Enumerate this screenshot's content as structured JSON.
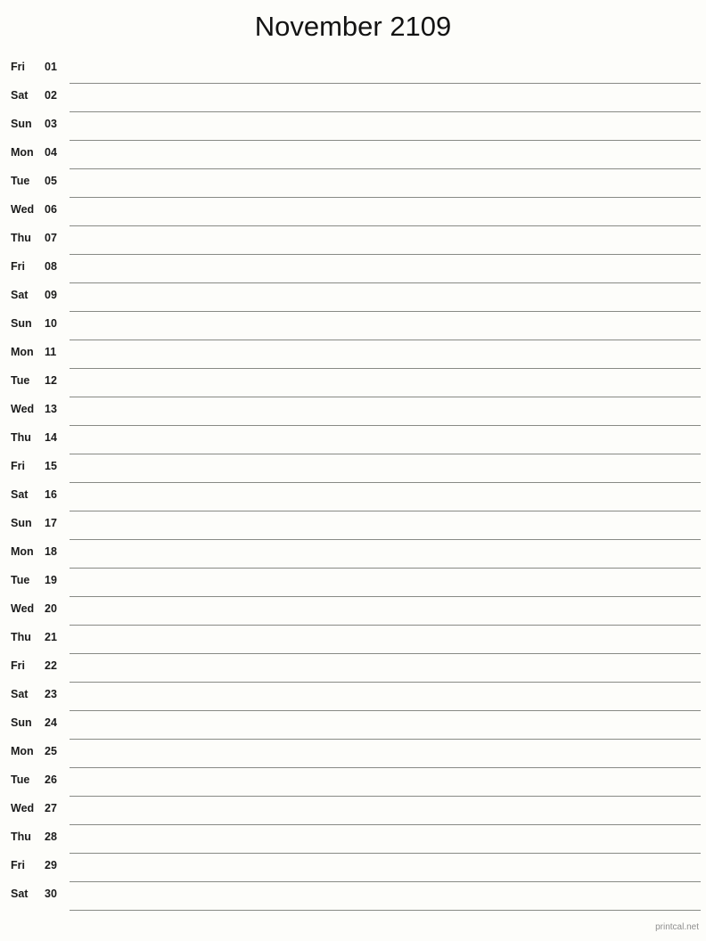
{
  "page": {
    "title": "November 2109",
    "month_name": "November",
    "year": "2109",
    "background_color": "#fdfdfa",
    "rule_color": "#888a85",
    "text_color": "#1b1b1b"
  },
  "footer": {
    "credit": "printcal.net"
  },
  "days": [
    {
      "weekday": "Fri",
      "date": "01"
    },
    {
      "weekday": "Sat",
      "date": "02"
    },
    {
      "weekday": "Sun",
      "date": "03"
    },
    {
      "weekday": "Mon",
      "date": "04"
    },
    {
      "weekday": "Tue",
      "date": "05"
    },
    {
      "weekday": "Wed",
      "date": "06"
    },
    {
      "weekday": "Thu",
      "date": "07"
    },
    {
      "weekday": "Fri",
      "date": "08"
    },
    {
      "weekday": "Sat",
      "date": "09"
    },
    {
      "weekday": "Sun",
      "date": "10"
    },
    {
      "weekday": "Mon",
      "date": "11"
    },
    {
      "weekday": "Tue",
      "date": "12"
    },
    {
      "weekday": "Wed",
      "date": "13"
    },
    {
      "weekday": "Thu",
      "date": "14"
    },
    {
      "weekday": "Fri",
      "date": "15"
    },
    {
      "weekday": "Sat",
      "date": "16"
    },
    {
      "weekday": "Sun",
      "date": "17"
    },
    {
      "weekday": "Mon",
      "date": "18"
    },
    {
      "weekday": "Tue",
      "date": "19"
    },
    {
      "weekday": "Wed",
      "date": "20"
    },
    {
      "weekday": "Thu",
      "date": "21"
    },
    {
      "weekday": "Fri",
      "date": "22"
    },
    {
      "weekday": "Sat",
      "date": "23"
    },
    {
      "weekday": "Sun",
      "date": "24"
    },
    {
      "weekday": "Mon",
      "date": "25"
    },
    {
      "weekday": "Tue",
      "date": "26"
    },
    {
      "weekday": "Wed",
      "date": "27"
    },
    {
      "weekday": "Thu",
      "date": "28"
    },
    {
      "weekday": "Fri",
      "date": "29"
    },
    {
      "weekday": "Sat",
      "date": "30"
    }
  ]
}
